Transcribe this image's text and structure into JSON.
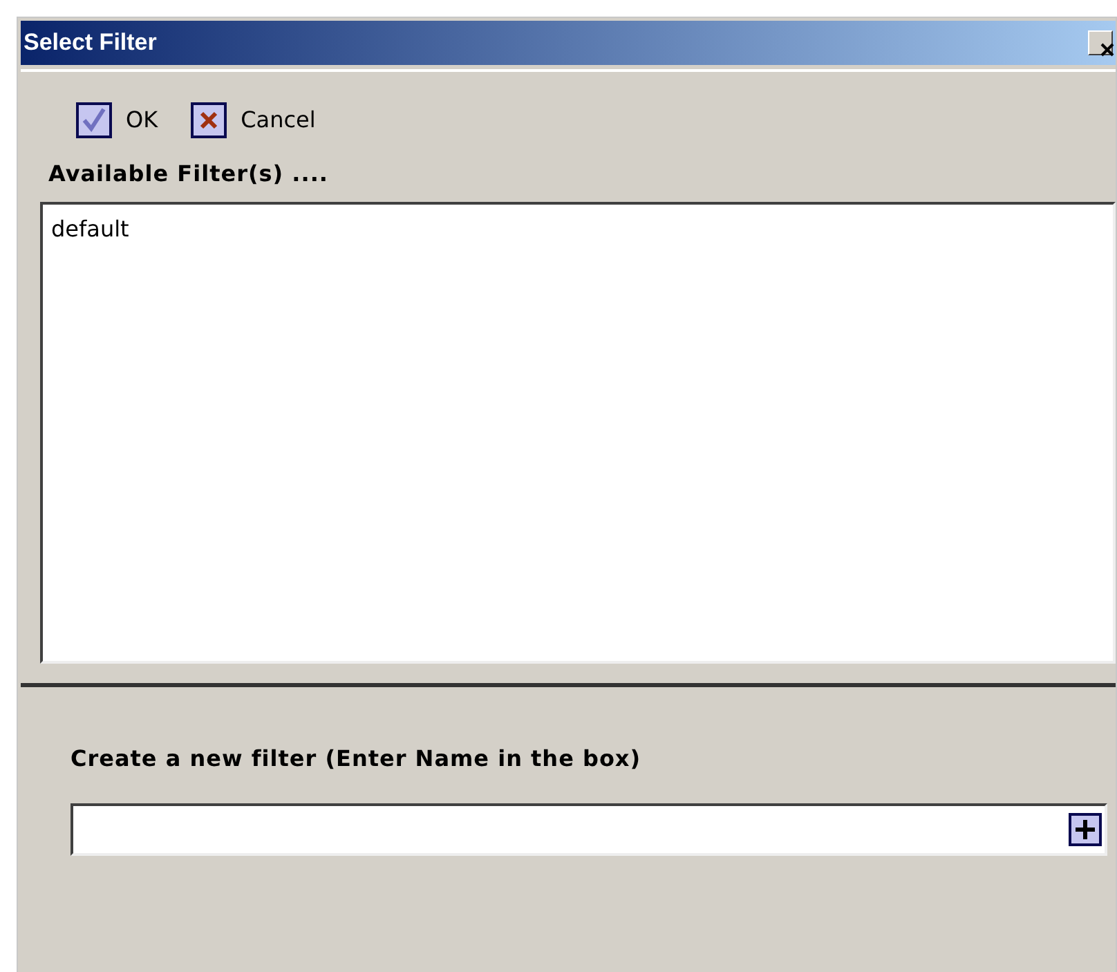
{
  "window": {
    "title": "Select Filter"
  },
  "toolbar": [
    {
      "kind": "ok",
      "label": "OK"
    },
    {
      "kind": "cancel",
      "label": "Cancel"
    }
  ],
  "available": {
    "label": "Available Filter(s) ....",
    "items": [
      {
        "label": "default",
        "selected": false
      }
    ]
  },
  "create": {
    "label": "Create a new filter (Enter Name in the box)"
  }
}
